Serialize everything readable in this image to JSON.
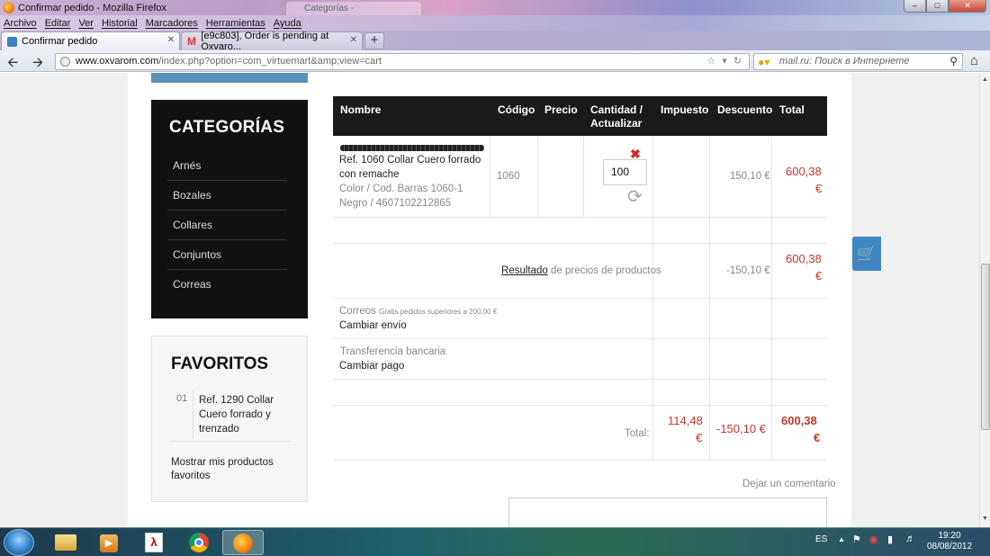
{
  "window": {
    "title": "Confirmar pedido - Mozilla Firefox",
    "ghost_tab": "Categorías - oxvarompedido..."
  },
  "menu": [
    "Archivo",
    "Editar",
    "Ver",
    "Historial",
    "Marcadores",
    "Herramientas",
    "Ayuda"
  ],
  "tabs": [
    {
      "label": "Confirmar pedido"
    },
    {
      "label": "[e9c803], Order is pending at Oxvaro..."
    }
  ],
  "url": {
    "host": "www.oxvarom.com",
    "path": "/index.php?option=com_virtuemart&amp;view=cart"
  },
  "search": {
    "placeholder": "mail.ru: Поиск в Интернете"
  },
  "sidebar": {
    "categories_title": "CATEGORÍAS",
    "categories": [
      "Arnés",
      "Bozales",
      "Collares",
      "Conjuntos",
      "Correas"
    ],
    "favorites_title": "FAVORITOS",
    "favorite_num": "01",
    "favorite_item": "Ref. 1290 Collar Cuero forrado y trenzado",
    "favorites_more": "Mostrar mis productos favoritos"
  },
  "cart": {
    "headers": {
      "name": "Nombre",
      "code": "Código",
      "price": "Precio",
      "qty_1": "Cantidad /",
      "qty_2": "Actualizar",
      "tax": "Impuesto",
      "discount": "Descuento",
      "total": "Total"
    },
    "product": {
      "name": "Ref. 1060 Collar Cuero forrado con remache",
      "variant": "Color / Cod. Barras 1060-1 Negro / 4607102212865",
      "code": "1060",
      "qty": "100",
      "discount": "150,10 €",
      "total_1": "600,38",
      "total_2": "€"
    },
    "subtotal": {
      "link": "Resultado",
      "label": "de precios de productos",
      "discount": "-150,10 €",
      "total_1": "600,38",
      "total_2": "€"
    },
    "shipping": {
      "name": "Correos",
      "note": "Gratis pedidos superiores a 200,00 €",
      "change": "Cambiar envío"
    },
    "payment": {
      "name": "Transferencia bancaria",
      "change": "Cambiar pago"
    },
    "grand": {
      "label": "Total:",
      "tax_1": "114,48",
      "tax_2": "€",
      "discount": "-150,10 €",
      "total_1": "600,38",
      "total_2": "€"
    },
    "comment_label": "Dejar un comentario"
  },
  "taskbar": {
    "lang": "ES",
    "time": "19:20",
    "date": "08/08/2012"
  },
  "colors": {
    "accent_red": "#c0392b",
    "sidebar_dark": "#111111",
    "cart_blue": "#3f86c3"
  }
}
